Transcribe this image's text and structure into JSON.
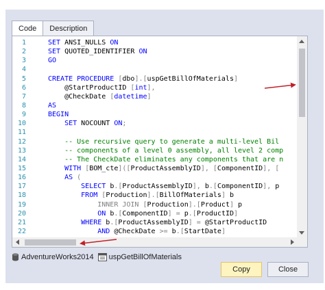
{
  "tabs": [
    {
      "label": "Code"
    },
    {
      "label": "Description"
    }
  ],
  "code_lines": [
    {
      "num": "1",
      "segments": [
        [
          "kw",
          "SET "
        ],
        [
          "pl",
          "ANSI_NULLS "
        ],
        [
          "kw",
          "ON"
        ]
      ]
    },
    {
      "num": "2",
      "segments": [
        [
          "kw",
          "SET "
        ],
        [
          "pl",
          "QUOTED_IDENTIFIER "
        ],
        [
          "kw",
          "ON"
        ]
      ]
    },
    {
      "num": "3",
      "segments": [
        [
          "kw",
          "GO"
        ]
      ]
    },
    {
      "num": "4",
      "segments": []
    },
    {
      "num": "5",
      "segments": [
        [
          "kw",
          "CREATE PROCEDURE "
        ],
        [
          "gy",
          "["
        ],
        [
          "pl",
          "dbo"
        ],
        [
          "gy",
          "]"
        ],
        [
          "gy",
          "."
        ],
        [
          "gy",
          "["
        ],
        [
          "pl",
          "uspGetBillOfMaterials"
        ],
        [
          "gy",
          "]"
        ]
      ]
    },
    {
      "num": "6",
      "segments": [
        [
          "pl",
          "    @StartProductID "
        ],
        [
          "gy",
          "["
        ],
        [
          "kw",
          "int"
        ],
        [
          "gy",
          "]"
        ],
        [
          "gy",
          ","
        ]
      ]
    },
    {
      "num": "7",
      "segments": [
        [
          "pl",
          "    @CheckDate "
        ],
        [
          "gy",
          "["
        ],
        [
          "kw",
          "datetime"
        ],
        [
          "gy",
          "]"
        ]
      ]
    },
    {
      "num": "8",
      "segments": [
        [
          "kw",
          "AS"
        ]
      ]
    },
    {
      "num": "9",
      "segments": [
        [
          "kw",
          "BEGIN"
        ]
      ]
    },
    {
      "num": "10",
      "segments": [
        [
          "kw",
          "    SET "
        ],
        [
          "pl",
          "NOCOUNT "
        ],
        [
          "kw",
          "ON"
        ],
        [
          "gy",
          ";"
        ]
      ]
    },
    {
      "num": "11",
      "segments": []
    },
    {
      "num": "12",
      "segments": [
        [
          "cm",
          "    -- Use recursive query to generate a multi-level Bil"
        ]
      ]
    },
    {
      "num": "13",
      "segments": [
        [
          "cm",
          "    -- components of a level 0 assembly, all level 2 comp"
        ]
      ]
    },
    {
      "num": "14",
      "segments": [
        [
          "cm",
          "    -- The CheckDate eliminates any components that are n"
        ]
      ]
    },
    {
      "num": "15",
      "segments": [
        [
          "kw",
          "    WITH "
        ],
        [
          "gy",
          "["
        ],
        [
          "pl",
          "BOM_cte"
        ],
        [
          "gy",
          "]"
        ],
        [
          "gy",
          "(["
        ],
        [
          "pl",
          "ProductAssemblyID"
        ],
        [
          "gy",
          "]"
        ],
        [
          "gy",
          ", "
        ],
        [
          "gy",
          "["
        ],
        [
          "pl",
          "ComponentID"
        ],
        [
          "gy",
          "]"
        ],
        [
          "gy",
          ", ["
        ]
      ]
    },
    {
      "num": "16",
      "segments": [
        [
          "kw",
          "    AS "
        ],
        [
          "gy",
          "("
        ]
      ]
    },
    {
      "num": "17",
      "segments": [
        [
          "kw",
          "        SELECT "
        ],
        [
          "pl",
          "b"
        ],
        [
          "gy",
          "."
        ],
        [
          "gy",
          "["
        ],
        [
          "pl",
          "ProductAssemblyID"
        ],
        [
          "gy",
          "]"
        ],
        [
          "gy",
          ", "
        ],
        [
          "pl",
          "b"
        ],
        [
          "gy",
          "."
        ],
        [
          "gy",
          "["
        ],
        [
          "pl",
          "ComponentID"
        ],
        [
          "gy",
          "]"
        ],
        [
          "gy",
          ", "
        ],
        [
          "pl",
          "p"
        ]
      ]
    },
    {
      "num": "18",
      "segments": [
        [
          "kw",
          "        FROM "
        ],
        [
          "gy",
          "["
        ],
        [
          "pl",
          "Production"
        ],
        [
          "gy",
          "]"
        ],
        [
          "gy",
          "."
        ],
        [
          "gy",
          "["
        ],
        [
          "pl",
          "BillOfMaterials"
        ],
        [
          "gy",
          "]"
        ],
        [
          "pl",
          " b"
        ]
      ]
    },
    {
      "num": "19",
      "segments": [
        [
          "gy",
          "            INNER JOIN "
        ],
        [
          "gy",
          "["
        ],
        [
          "pl",
          "Production"
        ],
        [
          "gy",
          "]"
        ],
        [
          "gy",
          "."
        ],
        [
          "gy",
          "["
        ],
        [
          "pl",
          "Product"
        ],
        [
          "gy",
          "]"
        ],
        [
          "pl",
          " p"
        ]
      ]
    },
    {
      "num": "20",
      "segments": [
        [
          "kw",
          "            ON "
        ],
        [
          "pl",
          "b"
        ],
        [
          "gy",
          "."
        ],
        [
          "gy",
          "["
        ],
        [
          "pl",
          "ComponentID"
        ],
        [
          "gy",
          "]"
        ],
        [
          "gy",
          " = "
        ],
        [
          "pl",
          "p"
        ],
        [
          "gy",
          "."
        ],
        [
          "gy",
          "["
        ],
        [
          "pl",
          "ProductID"
        ],
        [
          "gy",
          "]"
        ]
      ]
    },
    {
      "num": "21",
      "segments": [
        [
          "kw",
          "        WHERE "
        ],
        [
          "pl",
          "b"
        ],
        [
          "gy",
          "."
        ],
        [
          "gy",
          "["
        ],
        [
          "pl",
          "ProductAssemblyID"
        ],
        [
          "gy",
          "]"
        ],
        [
          "gy",
          " = "
        ],
        [
          "pl",
          "@StartProductID"
        ]
      ]
    },
    {
      "num": "22",
      "segments": [
        [
          "pl",
          "        "
        ],
        [
          "gy",
          "    "
        ],
        [
          "kw",
          "AND "
        ],
        [
          "pl",
          "@CheckDate "
        ],
        [
          "gy",
          ">= "
        ],
        [
          "pl",
          "b"
        ],
        [
          "gy",
          "."
        ],
        [
          "gy",
          "["
        ],
        [
          "pl",
          "StartDate"
        ],
        [
          "gy",
          "]"
        ]
      ]
    }
  ],
  "status": {
    "database": "AdventureWorks2014",
    "object": "uspGetBillOfMaterials"
  },
  "buttons": {
    "copy": "Copy",
    "close": "Close"
  },
  "colors": {
    "keyword": "#0000ff",
    "comment": "#008000",
    "operator": "#808080",
    "line_number": "#2b91af",
    "annotation_arrow": "#c0202a",
    "copy_button": "#fdf4bf"
  }
}
